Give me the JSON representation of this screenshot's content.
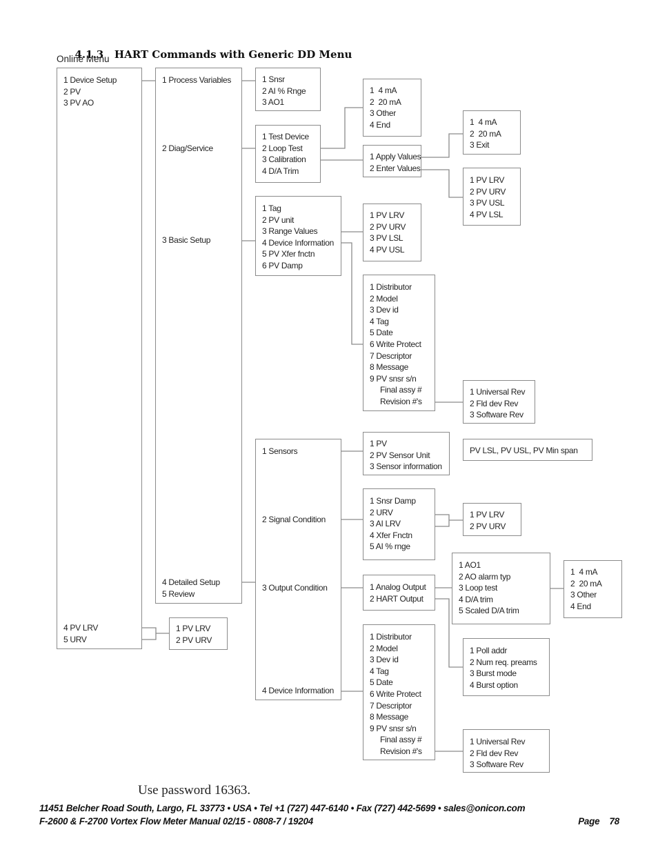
{
  "heading": {
    "number": "4.1.3",
    "title": "HART Commands with Generic DD Menu"
  },
  "online_menu_label": "Online Menu",
  "menus": {
    "root": [
      "1 Device Setup",
      "2 PV",
      "3 PV AO"
    ],
    "root_bottom": [
      "4 PV LRV",
      "5 URV"
    ],
    "device_setup": {
      "process_variables": "1 Process Variables",
      "diag_service": "2 Diag/Service",
      "basic_setup": "3 Basic Setup",
      "detailed_setup": "4 Detailed Setup",
      "review": "5 Review"
    },
    "pv_lrv_urv": [
      "1 PV LRV",
      "2 PV URV"
    ],
    "process_variables_sub": [
      "1 Snsr",
      "2 AI % Rnge",
      "3 AO1"
    ],
    "diag_service_sub": [
      "1 Test Device",
      "2 Loop Test",
      "3 Calibration",
      "4 D/A Trim"
    ],
    "loop_test_sub": [
      "1  4 mA",
      "2  20 mA",
      "3 Other",
      "4 End"
    ],
    "calibration_sub": [
      "1 Apply Values",
      "2 Enter Values"
    ],
    "apply_values_sub": [
      "1  4 mA",
      "2  20 mA",
      "3 Exit"
    ],
    "enter_values_sub": [
      "1 PV LRV",
      "2 PV URV",
      "3 PV USL",
      "4 PV LSL"
    ],
    "basic_setup_sub": [
      "1 Tag",
      "2 PV unit",
      "3 Range Values",
      "4 Device Information",
      "5 PV Xfer fnctn",
      "6 PV Damp"
    ],
    "range_values_sub": [
      "1 PV LRV",
      "2 PV URV",
      "3 PV LSL",
      "4 PV USL"
    ],
    "device_info_sub": [
      "1 Distributor",
      "2 Model",
      "3 Dev id",
      "4 Tag",
      "5 Date",
      "6 Write Protect",
      "7 Descriptor",
      "8 Message",
      "9 PV snsr s/n"
    ],
    "device_info_extra": [
      "Final assy #",
      "Revision #'s"
    ],
    "revision_sub": [
      "1 Universal Rev",
      "2 Fld dev Rev",
      "3 Software Rev"
    ],
    "detailed_setup_sub": {
      "sensors": "1 Sensors",
      "signal_condition": "2 Signal Condition",
      "output_condition": "3 Output Condition",
      "device_information": "4 Device Information"
    },
    "sensors_sub": [
      "1 PV",
      "2 PV Sensor Unit",
      "3 Sensor information"
    ],
    "sensor_info_text": "PV LSL, PV USL, PV Min span",
    "signal_condition_sub": [
      "1 Snsr Damp",
      "2 URV",
      "3 AI LRV",
      "4 Xfer Fnctn",
      "5 AI % rnge"
    ],
    "signal_pv_sub": [
      "1 PV LRV",
      "2 PV URV"
    ],
    "output_condition_sub": [
      "1 Analog Output",
      "2 HART Output"
    ],
    "analog_output_sub": [
      "1 AO1",
      "2 AO alarm typ",
      "3 Loop test",
      "4 D/A trim",
      "5 Scaled D/A trim"
    ],
    "ao_loop_test_sub": [
      "1  4 mA",
      "2  20 mA",
      "3 Other",
      "4 End"
    ],
    "hart_output_sub": [
      "1 Poll addr",
      "2 Num req. preams",
      "3 Burst mode",
      "4 Burst option"
    ],
    "device_info2_sub": [
      "1 Distributor",
      "2 Model",
      "3 Dev id",
      "4 Tag",
      "5 Date",
      "6 Write Protect",
      "7 Descriptor",
      "8 Message",
      "9 PV snsr s/n"
    ],
    "device_info2_extra": [
      "Final assy #",
      "Revision #'s"
    ],
    "revision2_sub": [
      "1 Universal Rev",
      "2 Fld dev Rev",
      "3 Software Rev"
    ]
  },
  "password_note": "Use password 16363.",
  "footer": {
    "address": "11451 Belcher Road South, Largo, FL 33773 • USA • Tel +1 (727) 447-6140 • Fax (727) 442-5699 • sales@onicon.com",
    "manual": "F-2600 & F-2700 Vortex Flow Meter Manual 02/15 - 0808-7 / 19204",
    "page": "Page    78"
  }
}
